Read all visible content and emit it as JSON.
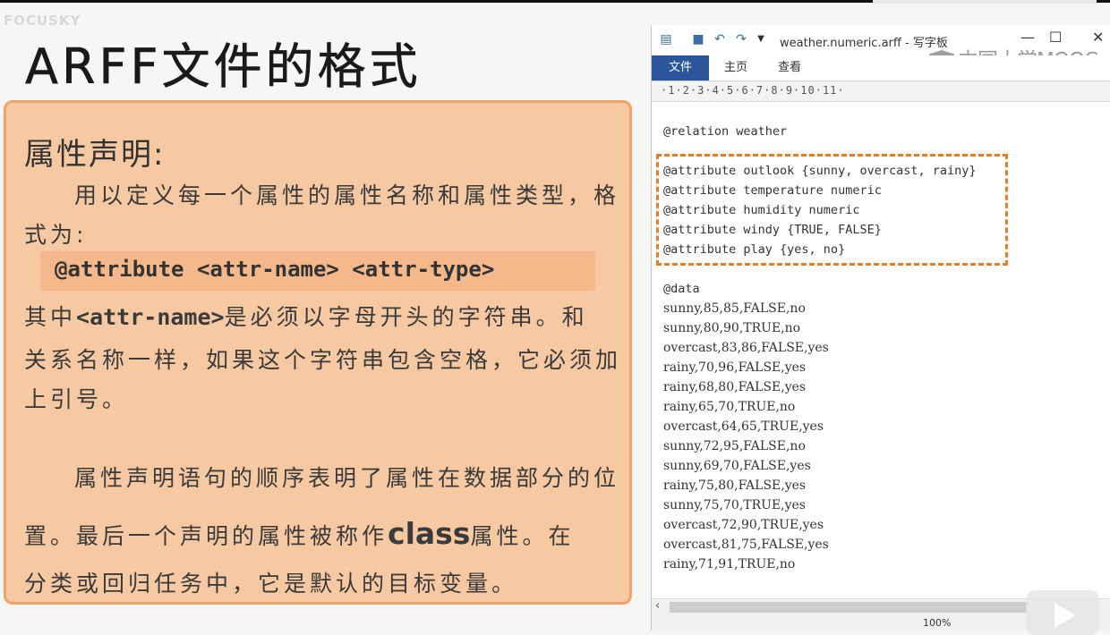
{
  "slide": {
    "brand": "FOCUSKY",
    "title": "ARFF文件的格式",
    "heading": "属性声明:",
    "para1_line1": "用以定义每一个属性的属性名称和属性类型，格",
    "para1_line2": "式为:",
    "code": "@attribute <attr-name> <attr-type>",
    "para2_prefix": "其中",
    "para2_code": "<attr-name>",
    "para2_suffix": "是必须以字母开头的字符串。和",
    "para2_line2": "关系名称一样，如果这个字符串包含空格，它必须加",
    "para2_line3": "上引号。",
    "para3_line1": "属性声明语句的顺序表明了属性在数据部分的位",
    "para3_line2_prefix": "置。最后一个声明的属性被称作",
    "para3_line2_class": "class",
    "para3_line2_suffix": "属性。在",
    "para3_line3": "分类或回归任务中，它是默认的目标变量。"
  },
  "window": {
    "title": "weather.numeric.arff - 写字板",
    "watermark": "中国大学MOOC",
    "tabs": [
      {
        "label": "文件",
        "active": true
      },
      {
        "label": "主页",
        "active": false
      },
      {
        "label": "查看",
        "active": false
      }
    ],
    "ruler": "·1·2·3·4·5·6·7·8·9·10·11·",
    "zoom": "100%",
    "accent_color": "#2b579a",
    "highlight_color": "#e0802a",
    "relation": "@relation weather",
    "attributes": [
      "@attribute outlook {sunny, overcast, rainy}",
      "@attribute temperature numeric",
      "@attribute humidity numeric",
      "@attribute windy {TRUE, FALSE}",
      "@attribute play {yes, no}"
    ],
    "data_label": "@data",
    "rows": [
      "sunny,85,85,FALSE,no",
      "sunny,80,90,TRUE,no",
      "overcast,83,86,FALSE,yes",
      "rainy,70,96,FALSE,yes",
      "rainy,68,80,FALSE,yes",
      "rainy,65,70,TRUE,no",
      "overcast,64,65,TRUE,yes",
      "sunny,72,95,FALSE,no",
      "sunny,69,70,FALSE,yes",
      "rainy,75,80,FALSE,yes",
      "sunny,75,70,TRUE,yes",
      "overcast,72,90,TRUE,yes",
      "overcast,81,75,FALSE,yes",
      "rainy,71,91,TRUE,no"
    ]
  }
}
